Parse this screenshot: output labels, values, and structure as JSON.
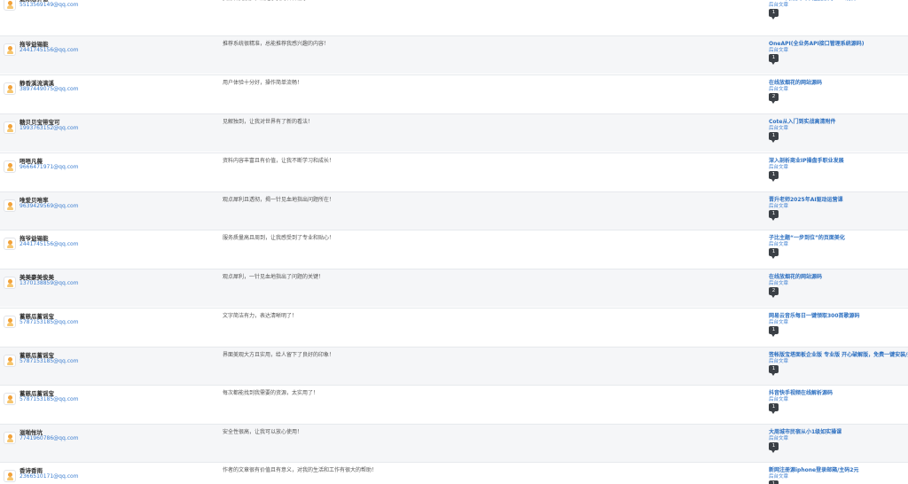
{
  "comments": [
    {
      "author": "魅际思钟德",
      "email": "5513569149@qq.com",
      "content": "资源种类繁多，满足了我的各种需求！",
      "post_title": "HTML简洁大气带进度条的URL跳转",
      "post_type": "后台文章",
      "count": "1"
    },
    {
      "author": "拖爷益锡能",
      "email": "2441745156@qq.com",
      "content": "推荐系统很精准，总能推荐我感兴趣的内容！",
      "post_title": "OneAPI(全业务API接口管理系统源码)",
      "post_type": "后台文章",
      "count": "1"
    },
    {
      "author": "静香溪流满溪",
      "email": "3897449075@qq.com",
      "content": "用户体验十分好，操作简单流畅！",
      "post_title": "在线放烟花的网站源码",
      "post_type": "后台文章",
      "count": "2"
    },
    {
      "author": "糖贝贝宝带宝可",
      "email": "1993763152@qq.com",
      "content": "见解独到，让我对世界有了新的看法！",
      "post_title": "Cote从入门到实战高清附件",
      "post_type": "后台文章",
      "count": "1"
    },
    {
      "author": "唔唔凡薇",
      "email": "9666471971@qq.com",
      "content": "资料内容丰富且有价值，让我不断学习和成长！",
      "post_title": "深入剖析商业IP操盘手职业发展",
      "post_type": "后台文章",
      "count": "1"
    },
    {
      "author": "唯爱贝唯率",
      "email": "9639429569@qq.com",
      "content": "观点犀利且透彻，揭一针见血地指出问题所在！",
      "post_title": "晋升老师2025年AI驱动运营课",
      "post_type": "后台文章",
      "count": "1"
    },
    {
      "author": "拖爷益锡能",
      "email": "2441745156@qq.com",
      "content": "服务质量高且周到，让我感受到了专业和贴心！",
      "post_title": "子比主题“一步到位”的页面美化",
      "post_type": "后台文章",
      "count": "1"
    },
    {
      "author": "美美豪美俊美",
      "email": "1370138859@qq.com",
      "content": "观点犀利，一针见血地指出了问题的关键！",
      "post_title": "在线放烟花的网站源码",
      "post_type": "后台文章",
      "count": "2"
    },
    {
      "author": "蓄慈瓜蓄谣宝",
      "email": "5787153185@qq.com",
      "content": "文字简洁有力，表达清晰明了！",
      "post_title": "网易云音乐每日一键领取300首歌源码",
      "post_type": "后台文章",
      "count": "1"
    },
    {
      "author": "蓄慈瓜蓄谣宝",
      "email": "5787153185@qq.com",
      "content": "界面美观大方且实用，给人留下了良好的印象！",
      "post_title": "签帐版宝塔面板企业版 专业版 开心破解版，免费一键安装/升级",
      "post_type": "后台文章",
      "count": "1"
    },
    {
      "author": "蓄慈瓜蓄谣宝",
      "email": "5787153185@qq.com",
      "content": "每次都能找到我需要的资源，太实用了！",
      "post_title": "抖音快手视频在线解析源码",
      "post_type": "后台文章",
      "count": "1"
    },
    {
      "author": "滋啪怅坑",
      "email": "7741960786@qq.com",
      "content": "安全性很高，让我可以放心使用！",
      "post_title": "大周城市民宿从小1级如实操课",
      "post_type": "后台文章",
      "count": "1"
    },
    {
      "author": "香诗香雨",
      "email": "2366510171@qq.com",
      "content": "作者的文章很有价值且有意义，对我的生活和工作有很大的帮助！",
      "post_title": "新网注册源iphone登录邮箱/主码2元",
      "post_type": "后台文章",
      "count": "1"
    }
  ]
}
